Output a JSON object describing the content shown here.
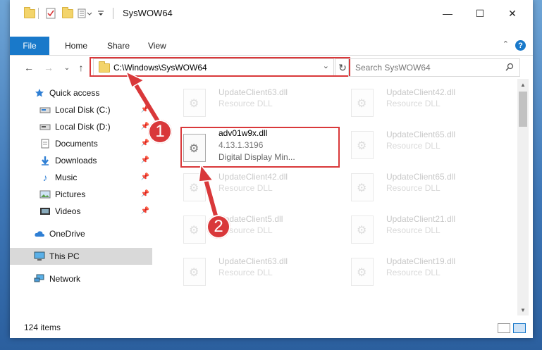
{
  "window": {
    "title": "SysWOW64",
    "controls": {
      "minimize": "—",
      "maximize": "☐",
      "close": "✕"
    }
  },
  "ribbon": {
    "tabs": [
      "File",
      "Home",
      "Share",
      "View"
    ],
    "help": "?",
    "collapse": "⌃"
  },
  "nav": {
    "back": "←",
    "forward": "→",
    "recent": "⌄",
    "up": "↑",
    "address": "C:\\Windows\\SysWOW64",
    "refresh": "↻",
    "search_placeholder": "Search SysWOW64"
  },
  "sidebar": {
    "items": [
      {
        "label": "Quick access",
        "icon": "star-icon",
        "pinned": false
      },
      {
        "label": "Local Disk (C:)",
        "icon": "drive-icon",
        "pinned": true
      },
      {
        "label": "Local Disk (D:)",
        "icon": "drive-icon",
        "pinned": true
      },
      {
        "label": "Documents",
        "icon": "documents-icon",
        "pinned": true
      },
      {
        "label": "Downloads",
        "icon": "download-icon",
        "pinned": true
      },
      {
        "label": "Music",
        "icon": "music-icon",
        "pinned": true
      },
      {
        "label": "Pictures",
        "icon": "pictures-icon",
        "pinned": true
      },
      {
        "label": "Videos",
        "icon": "videos-icon",
        "pinned": true
      },
      {
        "label": "OneDrive",
        "icon": "cloud-icon",
        "pinned": false
      },
      {
        "label": "This PC",
        "icon": "computer-icon",
        "pinned": false,
        "selected": true
      },
      {
        "label": "Network",
        "icon": "network-icon",
        "pinned": false
      }
    ]
  },
  "files": [
    {
      "name": "UpdateClient63.dll",
      "type": "Resource DLL"
    },
    {
      "name": "UpdateClient42.dll",
      "type": "Resource DLL"
    },
    {
      "name": "UpdateClient65.dll",
      "type": "Resource DLL"
    },
    {
      "name": "UpdateClient42.dll",
      "type": "Resource DLL"
    },
    {
      "name": "UpdateClient65.dll",
      "type": "Resource DLL"
    },
    {
      "name": "UpdateClient5.dll",
      "type": "Resource DLL"
    },
    {
      "name": "UpdateClient21.dll",
      "type": "Resource DLL"
    },
    {
      "name": "UpdateClient63.dll",
      "type": "Resource DLL"
    },
    {
      "name": "UpdateClient19.dll",
      "type": "Resource DLL"
    }
  ],
  "highlighted_file": {
    "name": "adv01w9x.dll",
    "version": "4.13.1.3196",
    "description": "Digital Display Min..."
  },
  "annotations": {
    "step1": "1",
    "step2": "2"
  },
  "status": {
    "items": "124 items"
  },
  "colors": {
    "accent": "#1979ca",
    "highlight": "#d9383a"
  }
}
